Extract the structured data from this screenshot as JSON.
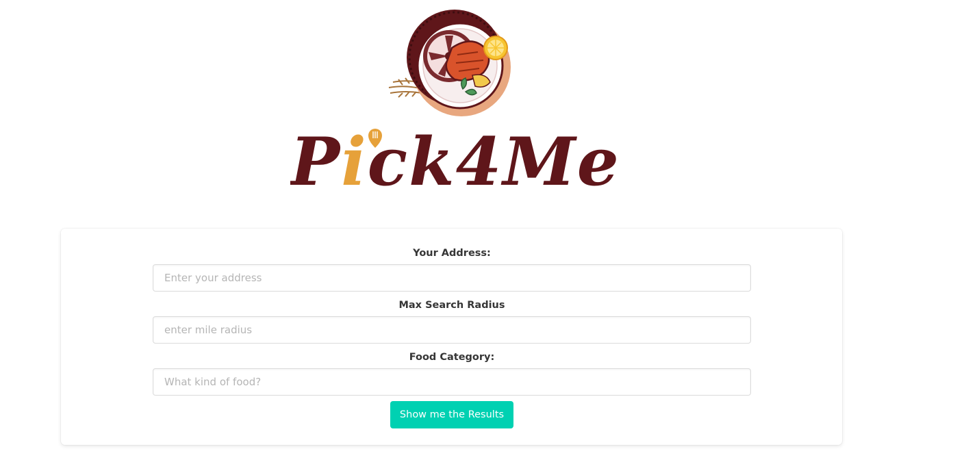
{
  "logo": {
    "wordmark": "Pick4Me",
    "emblem_icon": "tire-plate-food-icon",
    "colors": {
      "wordmark": "#5f161a",
      "accent": "#e6a13a"
    }
  },
  "form": {
    "address": {
      "label": "Your Address:",
      "placeholder": "Enter your address",
      "value": ""
    },
    "radius": {
      "label": "Max Search Radius",
      "placeholder": "enter mile radius",
      "value": ""
    },
    "category": {
      "label": "Food Category:",
      "placeholder": "What kind of food?",
      "value": ""
    },
    "submit_label": "Show me the Results"
  },
  "colors": {
    "button": "#00d1b2",
    "label_text": "#363636",
    "placeholder": "#b5b5b5"
  }
}
